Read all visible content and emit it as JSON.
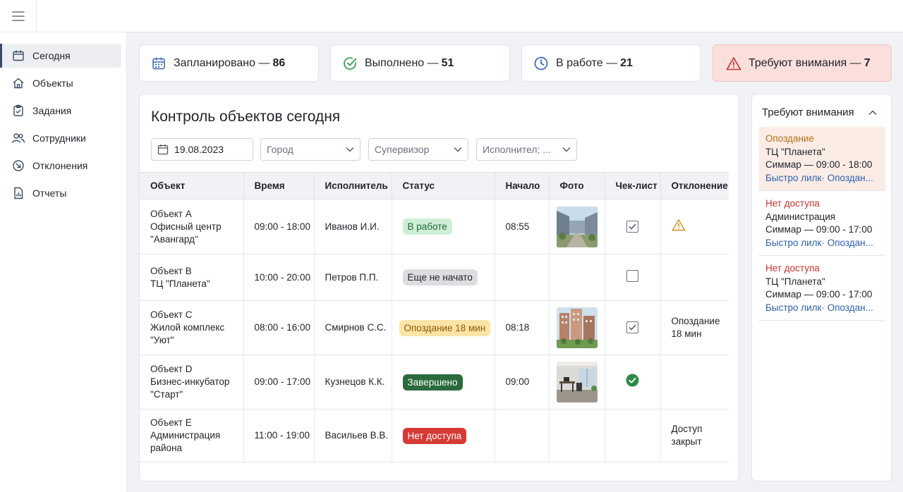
{
  "nav": {
    "items": [
      {
        "label": "Сегодня",
        "icon": "calendar-icon",
        "active": true
      },
      {
        "label": "Объекты",
        "icon": "home-icon"
      },
      {
        "label": "Задания",
        "icon": "clipboard-check-icon"
      },
      {
        "label": "Сотрудники",
        "icon": "users-icon"
      },
      {
        "label": "Отклонения",
        "icon": "deviation-icon"
      },
      {
        "label": "Отчеты",
        "icon": "report-icon"
      }
    ]
  },
  "stats": [
    {
      "label": "Запланировано —",
      "value": "86",
      "icon": "calendar-icon"
    },
    {
      "label": "Выполнено —",
      "value": "51",
      "icon": "check-circle-icon"
    },
    {
      "label": "В работе —",
      "value": "21",
      "icon": "clock-icon"
    },
    {
      "label": "Требуют внимания —",
      "value": "7",
      "icon": "warning-icon"
    }
  ],
  "main": {
    "title": "Контроль объектов сегодня",
    "filters": {
      "date": "19.08.2023",
      "city": "Город",
      "supervisor": "Супервизор",
      "executor": "Исполнител; ..."
    },
    "columns": [
      "Объект",
      "Время",
      "Исполнитель",
      "Статус",
      "Начало",
      "Фото",
      "Чек-лист",
      "Отклонение"
    ],
    "rows": [
      {
        "obj": [
          "Объект A",
          "Офисный центр",
          "\"Авангард\""
        ],
        "time": "09:00 - 18:00",
        "executor": "Иванов И.И.",
        "status": "В работе",
        "start": "08:55",
        "deviation": ""
      },
      {
        "obj": [
          "Объект B",
          "ТЦ \"Планета\""
        ],
        "time": "10:00 - 20:00",
        "executor": "Петров П.П.",
        "status": "Еще не начато",
        "start": "",
        "deviation": ""
      },
      {
        "obj": [
          "Объект C",
          "Жилой комплекс",
          "\"Уют\""
        ],
        "time": "08:00 - 16:00",
        "executor": "Смирнов С.С.",
        "status": "Опоздание 18 мин",
        "start": "08:18",
        "deviation": "Опоздание 18 мин"
      },
      {
        "obj": [
          "Объект D",
          "Бизнес-инкубатор",
          "\"Старт\""
        ],
        "time": "09:00 - 17:00",
        "executor": "Кузнецов К.К.",
        "status": "Завершено",
        "start": "09:00",
        "deviation": ""
      },
      {
        "obj": [
          "Объект E",
          "Администрация",
          "района"
        ],
        "time": "11:00 - 19:00",
        "executor": "Васильев В.В.",
        "status": "Нет доступа",
        "start": "",
        "deviation": "Доступ закрыт"
      }
    ]
  },
  "attention": {
    "title": "Требуют внимания",
    "items": [
      {
        "type": "Опоздание",
        "place": "ТЦ \"Планета\"",
        "detail": "Симмар — 09:00 - 18:00",
        "link": "Быстро лилк· Опоздан..."
      },
      {
        "type": "Нет доступа",
        "place": "Администрация",
        "detail": "Симмар — 09:00 - 17:00",
        "link": "Быстро лилк· Опоздан..."
      },
      {
        "type": "Нет доступа",
        "place": "ТЦ \"Планета\"",
        "detail": "Симмар — 09:00 - 17:00",
        "link": "Быстро лилк· Опоздан..."
      }
    ]
  },
  "colors": {
    "alert_bg": "#fbdfdd",
    "accent_green": "#2e9a4e",
    "accent_blue": "#2b5fb0",
    "warning": "#d9901a"
  }
}
